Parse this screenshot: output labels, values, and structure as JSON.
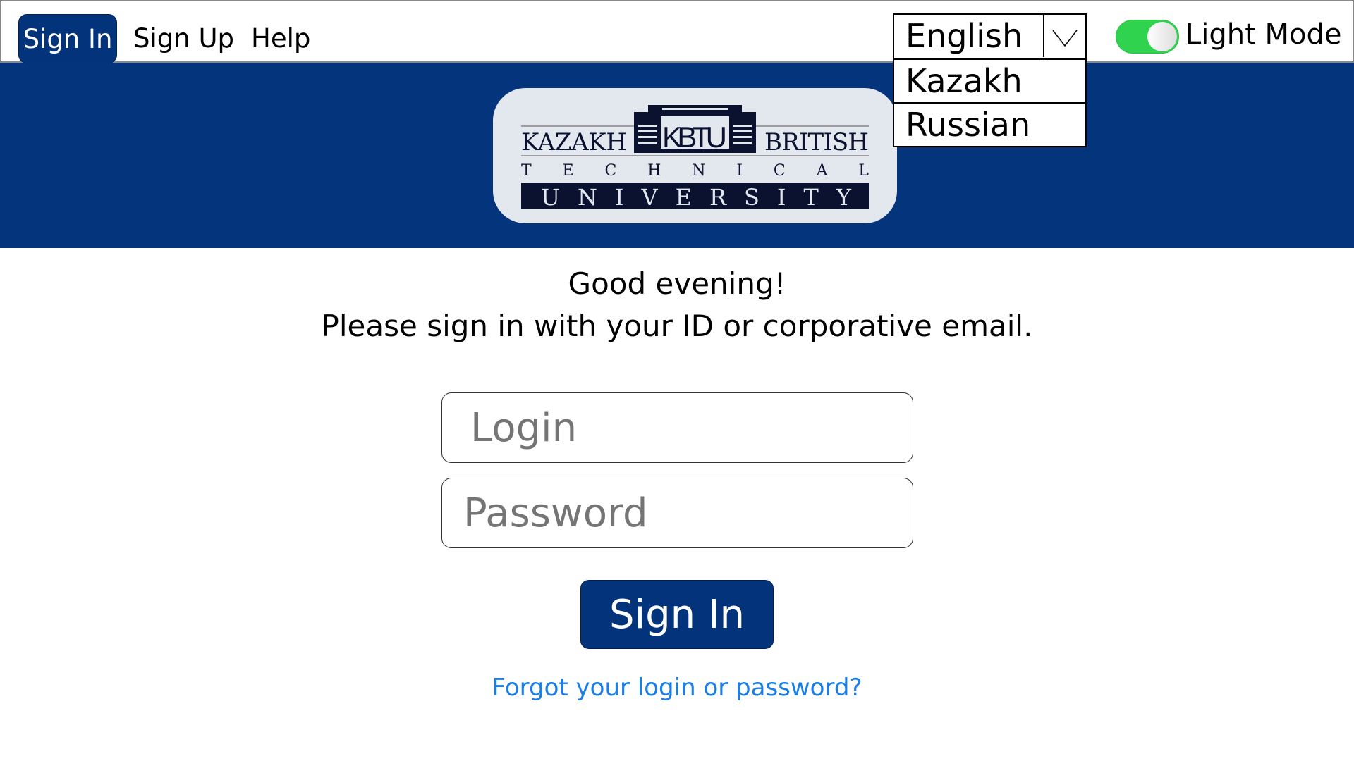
{
  "nav": {
    "sign_in": "Sign In",
    "sign_up": "Sign Up",
    "help": "Help"
  },
  "language": {
    "selected": "English",
    "options": [
      "Kazakh",
      "Russian"
    ]
  },
  "theme": {
    "label": "Light Mode",
    "enabled": true,
    "accent": "#2fd34e"
  },
  "logo": {
    "line1_left": "KAZAKH",
    "center": "KBTU",
    "line1_right": "BRITISH",
    "line2": "TECHNICAL",
    "line3": "UNIVERSITY"
  },
  "main": {
    "greeting": "Good evening!",
    "instruction": "Please sign in with your ID or corporative email.",
    "login_placeholder": "Login",
    "password_placeholder": "Password",
    "submit": "Sign In",
    "forgot": "Forgot your login or password?"
  },
  "colors": {
    "brand": "#03347c",
    "link": "#1a7ee8"
  }
}
